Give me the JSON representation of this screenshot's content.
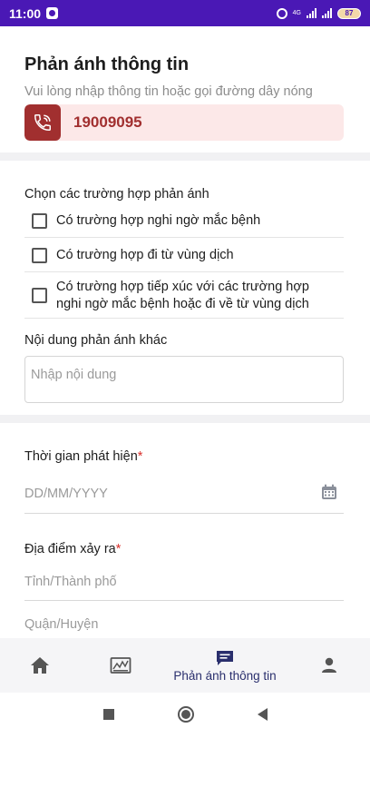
{
  "status_bar": {
    "time": "11:00",
    "network_1": "4G",
    "battery": "87"
  },
  "header": {
    "title": "Phản ánh thông tin",
    "subtitle": "Vui lòng nhập thông tin hoặc gọi đường dây nóng",
    "hotline_number": "19009095"
  },
  "cases": {
    "label": "Chọn các trường hợp phản ánh",
    "options": [
      {
        "label": "Có trường hợp nghi ngờ mắc bệnh",
        "checked": false
      },
      {
        "label": "Có trường hợp đi từ vùng dịch",
        "checked": false
      },
      {
        "label_line1": "Có trường hợp tiếp xúc với các trường hợp",
        "label_line2": "nghi ngờ mắc bệnh hoặc đi về từ vùng dịch",
        "checked": false
      }
    ]
  },
  "other_content": {
    "label": "Nội dung phản ánh khác",
    "placeholder": "Nhập nội dung"
  },
  "detection_time": {
    "label": "Thời gian phát hiện",
    "required_mark": "*",
    "placeholder": "DD/MM/YYYY"
  },
  "location": {
    "label": "Địa điểm xảy ra",
    "required_mark": "*",
    "province_placeholder": "Tỉnh/Thành phố",
    "district_placeholder": "Quận/Huyện"
  },
  "bottom_nav": {
    "active_label": "Phản ánh thông tin"
  },
  "colors": {
    "status_bar": "#4a18b5",
    "hotline_accent": "#a12f2f",
    "hotline_bg": "#fce8e8",
    "nav_active": "#2a2f6d",
    "required": "#d9302c"
  }
}
